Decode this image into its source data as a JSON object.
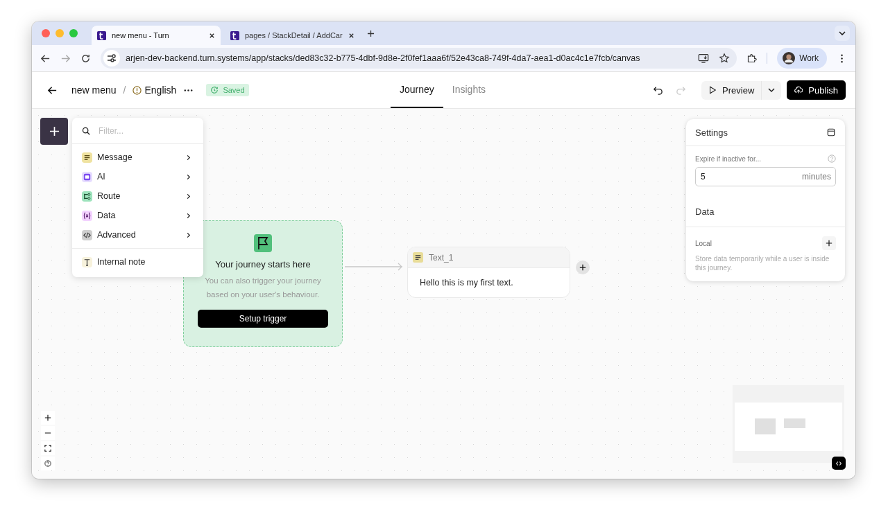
{
  "browser": {
    "tabs": [
      {
        "title": "new menu - Turn",
        "selected": true
      },
      {
        "title": "pages / StackDetail / AddCar",
        "selected": false
      }
    ],
    "url": "arjen-dev-backend.turn.systems/app/stacks/ded83c32-b775-4dbf-9d8e-2f0fef1aaa6f/52e43ca8-749f-4da7-aea1-d0ac4c1e7fcb/canvas",
    "profile": "Work"
  },
  "header": {
    "breadcrumb": [
      {
        "kind": "page",
        "label": "new menu"
      },
      {
        "kind": "separator",
        "label": "/"
      },
      {
        "kind": "language",
        "label": "English"
      }
    ],
    "status": "Saved",
    "tabs": [
      {
        "label": "Journey",
        "selected": true
      },
      {
        "label": "Insights",
        "selected": false
      }
    ],
    "history": [
      {
        "kind": "undo",
        "disabled": false
      },
      {
        "kind": "redo",
        "disabled": true
      }
    ],
    "preview": "Preview",
    "publish": "Publish"
  },
  "add_menu": {
    "placeholder": "Filter...",
    "items": [
      {
        "kind": "message",
        "label": "Message",
        "submenu": true
      },
      {
        "kind": "ai",
        "label": "AI",
        "submenu": true
      },
      {
        "kind": "route",
        "label": "Route",
        "submenu": true
      },
      {
        "kind": "data",
        "label": "Data",
        "submenu": true
      },
      {
        "kind": "advanced",
        "label": "Advanced",
        "submenu": true
      },
      {
        "kind": "note",
        "label": "Internal note",
        "submenu": false
      }
    ]
  },
  "trigger_node": {
    "title": "Your journey starts here",
    "description": "You can also trigger your journey based on your user's behaviour.",
    "button": "Setup trigger"
  },
  "text_node": {
    "title": "Text_1",
    "body": "Hello this is my first text."
  },
  "settings": {
    "title": "Settings",
    "expire_label": "Expire if inactive for...",
    "expire_value": "5",
    "expire_unit": "minutes",
    "data_title": "Data",
    "local_label": "Local",
    "local_hint": "Store data temporarily while a user is inside this journey."
  }
}
